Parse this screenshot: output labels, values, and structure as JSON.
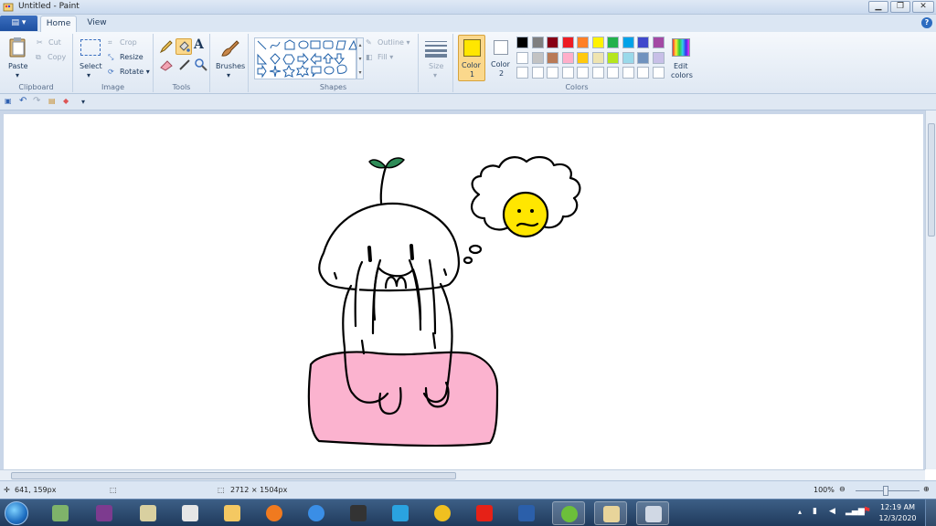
{
  "window": {
    "title": "Untitled - Paint"
  },
  "tabs": {
    "file": "▤ ▾",
    "home": "Home",
    "view": "View"
  },
  "ribbon": {
    "clipboard": {
      "label": "Clipboard",
      "paste": "Paste",
      "cut": "Cut",
      "copy": "Copy"
    },
    "image": {
      "label": "Image",
      "select": "Select",
      "crop": "Crop",
      "resize": "Resize",
      "rotate": "Rotate ▾"
    },
    "tools": {
      "label": "Tools"
    },
    "brushes": {
      "label": "Brushes"
    },
    "shapes": {
      "label": "Shapes",
      "outline": "Outline ▾",
      "fill": "Fill ▾"
    },
    "size": {
      "label": "Size"
    },
    "colors": {
      "label": "Colors",
      "color1_label": "Color",
      "color1_num": "1",
      "color2_label": "Color",
      "color2_num": "2",
      "color1": "#ffe600",
      "color2": "#ffffff",
      "edit_label": "Edit",
      "edit_label2": "colors",
      "palette_row1": [
        "#000000",
        "#7f7f7f",
        "#880015",
        "#ed1c24",
        "#ff7f27",
        "#fff200",
        "#22b14c",
        "#00a2e8",
        "#3f48cc",
        "#a349a4"
      ],
      "palette_row2": [
        "#ffffff",
        "#c3c3c3",
        "#b97a57",
        "#ffaec9",
        "#ffc90e",
        "#efe4b0",
        "#b5e61d",
        "#99d9ea",
        "#7092be",
        "#c8bfe7"
      ],
      "palette_row3": [
        "#ffffff",
        "#ffffff",
        "#ffffff",
        "#ffffff",
        "#ffffff",
        "#ffffff",
        "#ffffff",
        "#ffffff",
        "#ffffff",
        "#ffffff"
      ]
    }
  },
  "statusbar": {
    "cursor_pos": "641, 159px",
    "image_size": "2712 × 1504px",
    "zoom": "100%"
  },
  "taskbar": {
    "time": "12:19 AM",
    "date": "12/3/2020"
  }
}
